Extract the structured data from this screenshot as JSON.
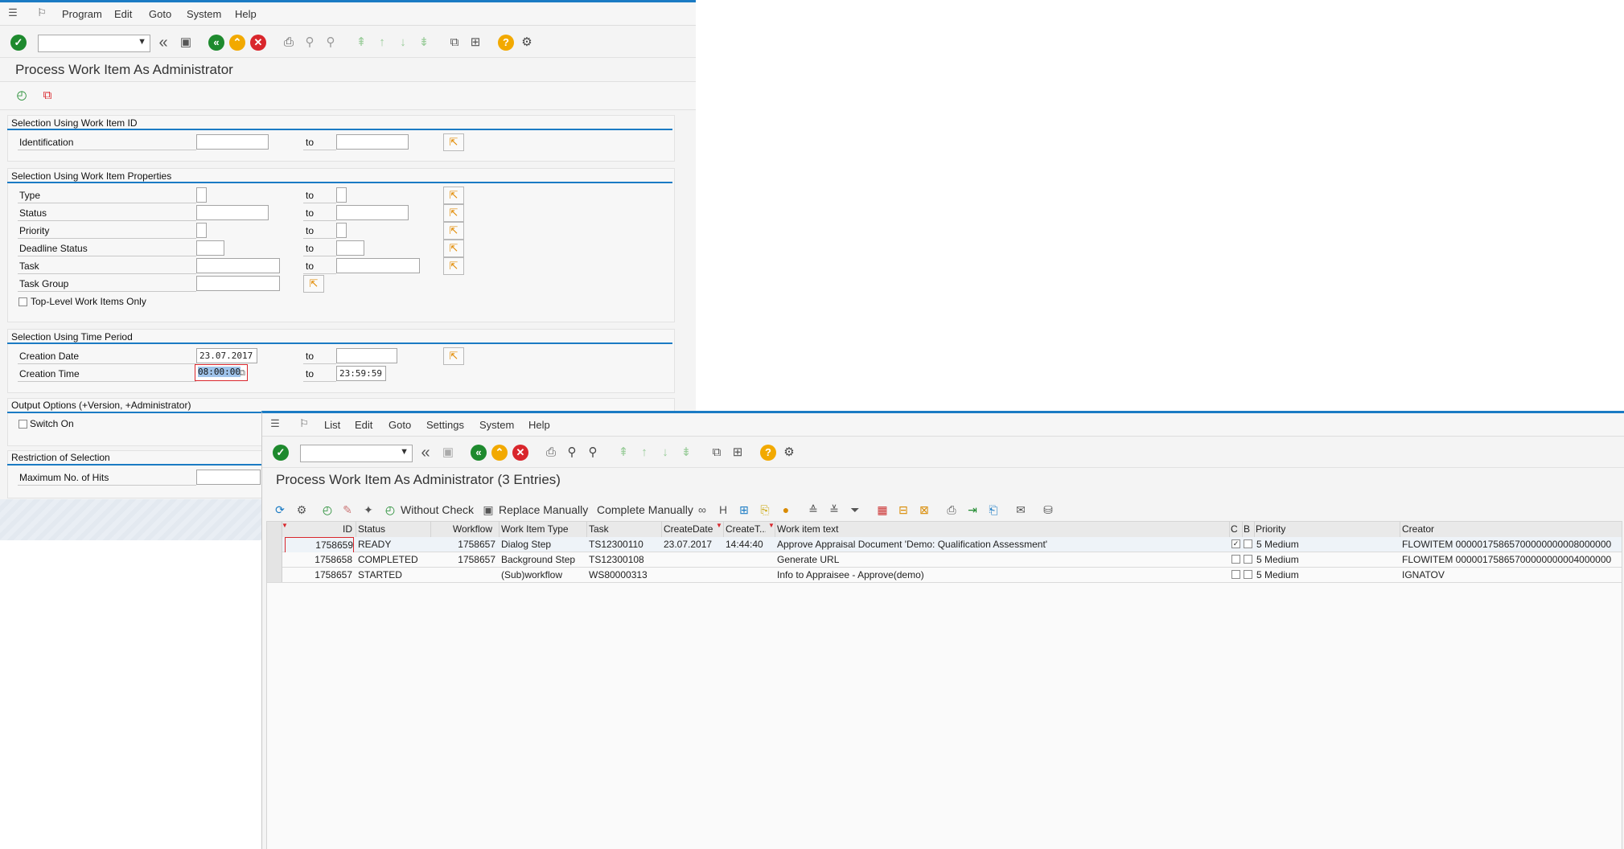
{
  "colors": {
    "accent": "#1b7bc4",
    "ok_green": "#1e8a2e",
    "cancel_red": "#d9262c",
    "warn_orange": "#f2a900"
  },
  "window1": {
    "menu": [
      "Program",
      "Edit",
      "Goto",
      "System",
      "Help"
    ],
    "title": "Process Work Item As Administrator",
    "section_id": {
      "title": "Selection Using Work Item ID",
      "rows": [
        {
          "label": "Identification",
          "to": "to",
          "from_value": "",
          "to_value": ""
        }
      ]
    },
    "section_props": {
      "title": "Selection Using Work Item Properties",
      "rows": [
        {
          "label": "Type",
          "to": "to"
        },
        {
          "label": "Status",
          "to": "to"
        },
        {
          "label": "Priority",
          "to": "to"
        },
        {
          "label": "Deadline Status",
          "to": "to"
        },
        {
          "label": "Task",
          "to": "to"
        },
        {
          "label": "Task Group"
        }
      ],
      "checkbox_label": "Top-Level Work Items Only"
    },
    "section_time": {
      "title": "Selection Using Time Period",
      "creation_date_label": "Creation Date",
      "creation_date_value": "23.07.2017",
      "creation_time_label": "Creation Time",
      "creation_time_value": "08:00:00",
      "creation_time_to": "23:59:59",
      "to": "to"
    },
    "section_output": {
      "title": "Output Options (+Version, +Administrator)",
      "switch_label": "Switch On"
    },
    "section_restrict": {
      "title": "Restriction of Selection",
      "max_hits_label": "Maximum No. of Hits"
    }
  },
  "window2": {
    "menu": [
      "List",
      "Edit",
      "Goto",
      "Settings",
      "System",
      "Help"
    ],
    "title": "Process Work Item As Administrator (3 Entries)",
    "buttons": {
      "without_check": "Without Check",
      "replace_manually": "Replace Manually",
      "complete_manually": "Complete Manually"
    },
    "columns": [
      "ID",
      "Status",
      "Workflow",
      "Work Item Type",
      "Task",
      "CreateDate",
      "CreateT...",
      "Work item text",
      "C",
      "B",
      "Priority",
      "Creator"
    ],
    "rows": [
      {
        "id": "1758659",
        "status": "READY",
        "workflow": "1758657",
        "type": "Dialog Step",
        "task": "TS12300110",
        "date": "23.07.2017",
        "time": "14:44:40",
        "text": "Approve Appraisal Document 'Demo: Qualification Assessment'",
        "c_checked": true,
        "priority": "5 Medium",
        "creator": "FLOWITEM  00000175865700000000008000000"
      },
      {
        "id": "1758658",
        "status": "COMPLETED",
        "workflow": "1758657",
        "type": "Background Step",
        "task": "TS12300108",
        "date": "",
        "time": "",
        "text": "Generate URL",
        "c_checked": false,
        "priority": "5 Medium",
        "creator": "FLOWITEM  00000175865700000000004000000"
      },
      {
        "id": "1758657",
        "status": "STARTED",
        "workflow": "",
        "type": "(Sub)workflow",
        "task": "WS80000313",
        "date": "",
        "time": "",
        "text": "Info to Appraisee - Approve(demo)",
        "c_checked": false,
        "priority": "5 Medium",
        "creator": "IGNATOV"
      }
    ]
  }
}
